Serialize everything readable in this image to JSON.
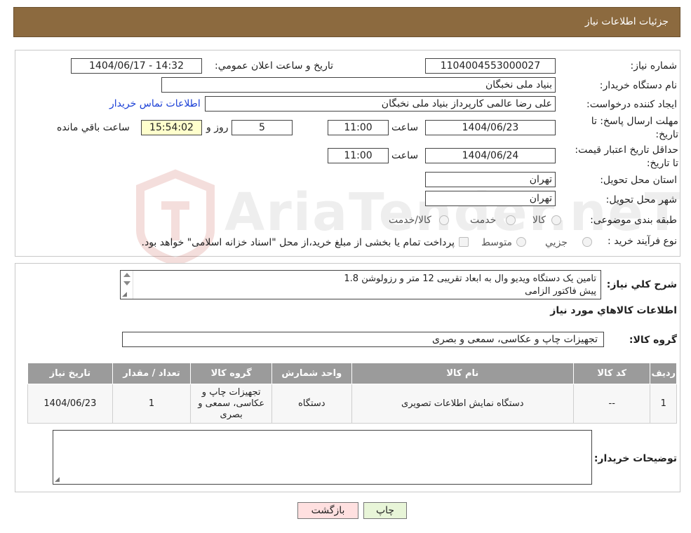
{
  "header": {
    "title": "جزئیات اطلاعات نیاز"
  },
  "form": {
    "need_number_label": "شماره نیاز:",
    "need_number": "1104004553000027",
    "announce_label": "تاریخ و ساعت اعلان عمومي:",
    "announce_value": "1404/06/17 - 14:32",
    "buyer_org_label": "نام دستگاه خريدار:",
    "buyer_org": "بنیاد ملی نخبگان",
    "creator_label": "ايجاد کننده درخواست:",
    "creator": "علی رضا عالمی کارپرداز بنیاد ملی نخبگان",
    "contact_link": "اطلاعات تماس خریدار",
    "deadline_label": "مهلت ارسال پاسخ: تا تاریخ:",
    "deadline_date": "1404/06/23",
    "time_label": "ساعت",
    "deadline_time": "11:00",
    "days_value": "5",
    "days_and": "روز و",
    "remaining_time": "15:54:02",
    "remaining_label": "ساعت باقي مانده",
    "validity_label": "حداقل تاریخ اعتبار قیمت: تا تاریخ:",
    "validity_date": "1404/06/24",
    "validity_time": "11:00",
    "province_label": "استان محل تحویل:",
    "province": "تهران",
    "city_label": "شهر محل تحویل:",
    "city": "تهران",
    "category_label": "طبقه بندی موضوعی:",
    "category_options": [
      "کالا",
      "خدمت",
      "کالا/خدمت"
    ],
    "process_label": "نوع فرآيند خريد :",
    "process_options": [
      "جزيي",
      "متوسط"
    ],
    "process_note": "پرداخت تمام یا بخشی از مبلغ خرید،از محل \"اسناد خزانه اسلامی\" خواهد بود."
  },
  "watermark": {
    "text": "AriaTender.neT"
  },
  "description": {
    "label": "شرح کلي نياز:",
    "line1": "تامین یک دستگاه ویدیو وال به ابعاد تقریبی 12 متر و رزولوشن 1.8",
    "line2": "پیش فاکتور الزامی"
  },
  "goods": {
    "section_title": "اطلاعات کالاهاي مورد نياز",
    "group_label": "گروه کالا:",
    "group_value": "تجهیزات چاپ و عکاسی، سمعی و بصری",
    "columns": [
      "رديف",
      "کد کالا",
      "نام کالا",
      "واحد شمارش",
      "گروه کالا",
      "تعداد / مقدار",
      "تاریخ نیاز"
    ],
    "rows": [
      {
        "index": "1",
        "code": "--",
        "name": "دستگاه نمایش اطلاعات تصویری",
        "unit": "دستگاه",
        "group": "تجهیزات چاپ و عکاسی، سمعی و بصری",
        "qty": "1",
        "date": "1404/06/23"
      }
    ]
  },
  "buyer_notes": {
    "label": "توضیحات خريدار:"
  },
  "buttons": {
    "print": "چاپ",
    "back": "بازگشت"
  },
  "colors": {
    "header_bg": "#8c6a3f",
    "table_header_bg": "#9b9b9b",
    "back_btn_bg": "#ffe0e0",
    "print_btn_bg": "#e8f5d8"
  }
}
